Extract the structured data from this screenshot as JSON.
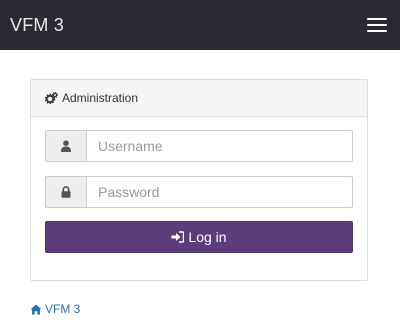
{
  "navbar": {
    "brand": "VFM 3",
    "menu_icon": "hamburger-menu-icon"
  },
  "panel": {
    "heading": "Administration",
    "heading_icon": "gears-icon"
  },
  "form": {
    "username_placeholder": "Username",
    "username_value": "",
    "username_icon": "user-icon",
    "password_placeholder": "Password",
    "password_value": "",
    "password_icon": "lock-icon",
    "login_label": "Log in",
    "login_icon": "sign-in-icon"
  },
  "footer": {
    "home_link": "VFM 3",
    "home_icon": "home-icon"
  },
  "colors": {
    "navbar_bg": "#2b2a33",
    "button_bg": "#5c3d7c",
    "link": "#2a6fb0"
  }
}
